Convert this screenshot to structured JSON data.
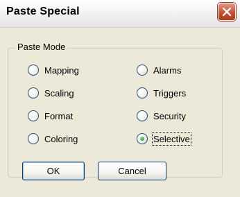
{
  "dialog": {
    "title": "Paste Special",
    "group_label": "Paste Mode",
    "options_left": [
      {
        "label": "Mapping",
        "checked": false
      },
      {
        "label": "Scaling",
        "checked": false
      },
      {
        "label": "Format",
        "checked": false
      },
      {
        "label": "Coloring",
        "checked": false
      }
    ],
    "options_right": [
      {
        "label": "Alarms",
        "checked": false
      },
      {
        "label": "Triggers",
        "checked": false
      },
      {
        "label": "Security",
        "checked": false
      },
      {
        "label": "Selective",
        "checked": true
      }
    ],
    "ok_label": "OK",
    "cancel_label": "Cancel"
  },
  "icons": {
    "close": "close-icon"
  },
  "colors": {
    "close_button": "#c8492a",
    "button_border": "#003c74",
    "dialog_bg": "#ece9d8"
  }
}
